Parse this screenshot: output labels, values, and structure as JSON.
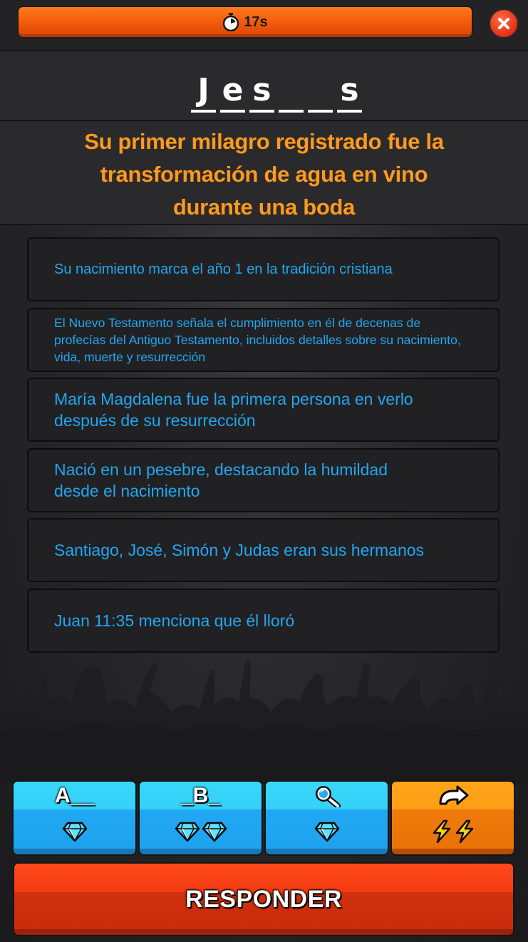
{
  "timer": {
    "label": "17s",
    "icon": "stopwatch-icon",
    "color": "#f0560a"
  },
  "header": {
    "close_icon": "close-icon"
  },
  "answer": {
    "slots": [
      "J",
      "e",
      "s",
      "",
      "",
      "s"
    ]
  },
  "clue": {
    "line1": "Su primer milagro registrado fue la",
    "line2": "transformación de agua en vino",
    "line3": "durante una boda"
  },
  "clues": [
    "Su nacimiento marca el año 1 en la tradición cristiana",
    "El Nuevo Testamento señala el cumplimiento en él de decenas de profecías del Antiguo Testamento, incluidos detalles sobre su nacimiento, vida, muerte y resurrección",
    "María Magdalena fue la primera persona en verlo después de su resurrección",
    "Nació en un pesebre, destacando la humildad desde el nacimiento",
    "Santiago, José, Simón y Judas eran sus hermanos",
    "Juan 11:35 menciona que él lloró"
  ],
  "powerups": [
    {
      "label": "A__",
      "cost_icon": "diamond-icon",
      "cost_count": 1
    },
    {
      "label": "_B_",
      "cost_icon": "diamond-icon",
      "cost_count": 2
    },
    {
      "label": "",
      "icon": "magnifier-icon",
      "cost_icon": "diamond-icon",
      "cost_count": 1
    },
    {
      "label": "",
      "icon": "skip-arrow-icon",
      "cost_icon": "lightning-icon",
      "cost_count": 2
    }
  ],
  "submit": {
    "label": "RESPONDER"
  },
  "colors": {
    "accent_orange": "#ff9a1c",
    "clue_blue": "#22a6f0",
    "submit_red": "#e0350e",
    "powerup_blue": "#22a9f3",
    "powerup_orange": "#f07a0a"
  }
}
